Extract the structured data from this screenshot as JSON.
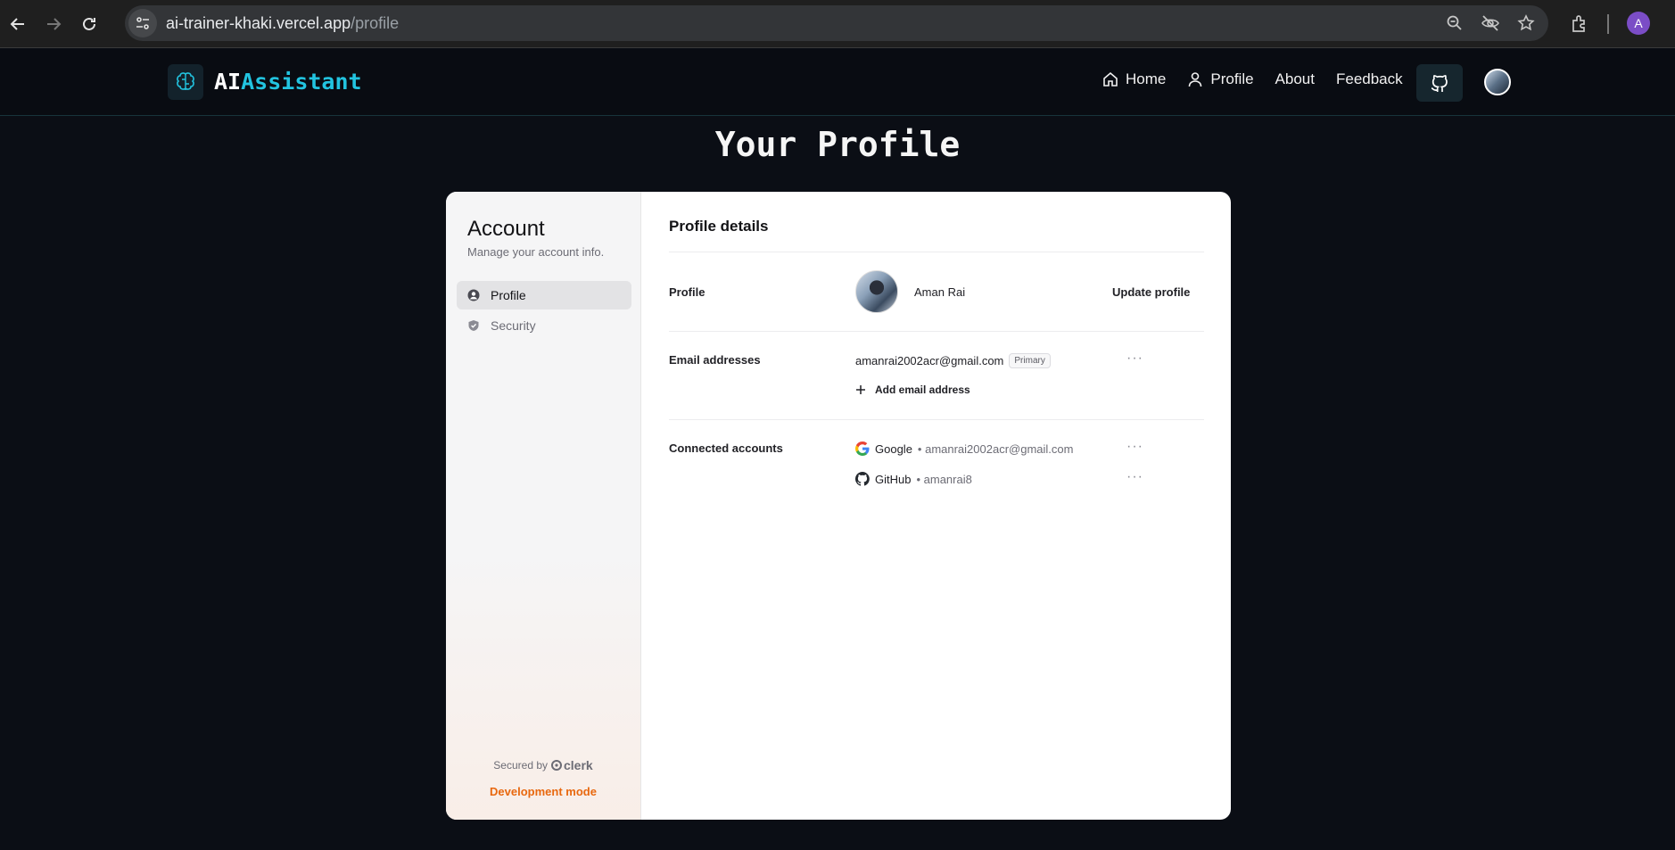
{
  "browser": {
    "url_host": "ai-trainer-khaki.vercel.app",
    "url_path": "/profile",
    "profile_initial": "A"
  },
  "header": {
    "logo_part1": "AI",
    "logo_part2": "Assistant",
    "nav": [
      {
        "label": "Home",
        "icon": "home-icon"
      },
      {
        "label": "Profile",
        "icon": "user-icon"
      },
      {
        "label": "About"
      },
      {
        "label": "Feedback"
      }
    ],
    "accent_color": "#22c4e0"
  },
  "page": {
    "title": "Your Profile"
  },
  "account": {
    "title": "Account",
    "subtitle": "Manage your account info.",
    "menu": [
      {
        "label": "Profile",
        "icon": "user-circle-icon",
        "active": true
      },
      {
        "label": "Security",
        "icon": "shield-icon",
        "active": false
      }
    ],
    "secured_by": "Secured by",
    "brand": "clerk",
    "dev_mode": "Development mode"
  },
  "profile_details": {
    "title": "Profile details",
    "profile_label": "Profile",
    "name": "Aman Rai",
    "update_label": "Update profile",
    "email_label": "Email addresses",
    "email": "amanrai2002acr@gmail.com",
    "email_badge": "Primary",
    "add_email": "Add email address",
    "connected_label": "Connected accounts",
    "accounts": [
      {
        "provider": "Google",
        "detail": "• amanrai2002acr@gmail.com",
        "icon": "google-icon"
      },
      {
        "provider": "GitHub",
        "detail": "• amanrai8",
        "icon": "github-icon"
      }
    ],
    "more": "···"
  }
}
